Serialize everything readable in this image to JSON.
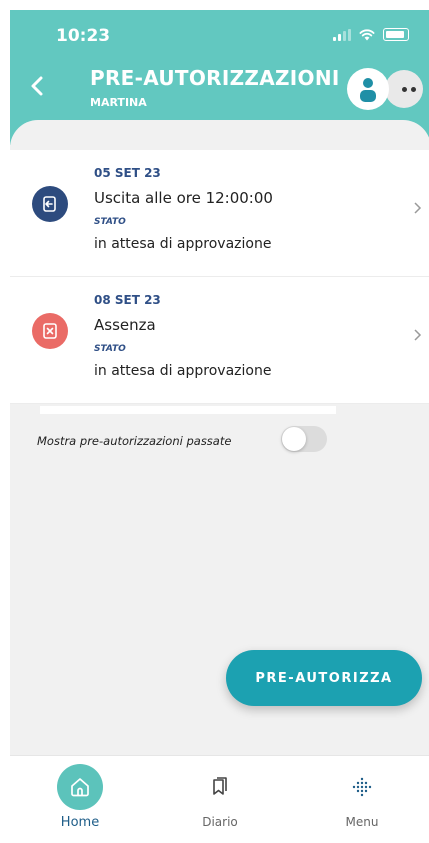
{
  "status_bar": {
    "time": "10:23"
  },
  "header": {
    "title": "PRE-AUTORIZZAZIONI",
    "subtitle": "MARTINA",
    "accent_color": "#62c8c0"
  },
  "items": [
    {
      "date": "05 SET 23",
      "description": "Uscita alle ore 12:00:00",
      "state_label": "STATO",
      "state_value": "in attesa di approvazione",
      "icon": "exit-door-icon",
      "icon_color": "#2d4b7e"
    },
    {
      "date": "08 SET 23",
      "description": "Assenza",
      "state_label": "STATO",
      "state_value": "in attesa di approvazione",
      "icon": "absence-x-icon",
      "icon_color": "#ea6b66"
    }
  ],
  "toggle": {
    "label": "Mostra pre-autorizzazioni passate",
    "enabled": false
  },
  "fab": {
    "label": "PRE-AUTORIZZA",
    "color": "#1ca1b1"
  },
  "bottom_nav": {
    "items": [
      {
        "label": "Home",
        "icon": "home-icon",
        "active": true
      },
      {
        "label": "Diario",
        "icon": "bookmarks-icon",
        "active": false
      },
      {
        "label": "Menu",
        "icon": "dots-grid-icon",
        "active": false
      }
    ]
  }
}
